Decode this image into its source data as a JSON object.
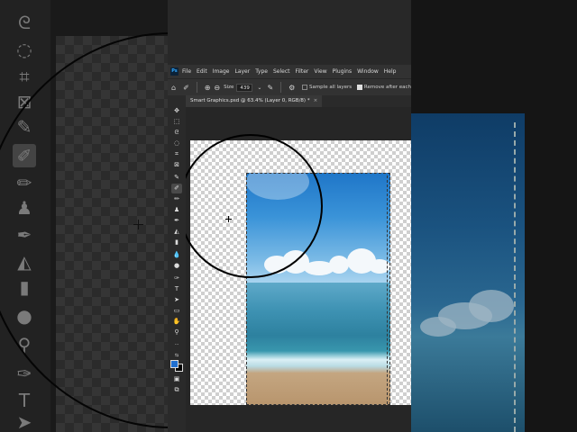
{
  "menubar": {
    "logo": "Ps",
    "items": [
      "File",
      "Edit",
      "Image",
      "Layer",
      "Type",
      "Select",
      "Filter",
      "View",
      "Plugins",
      "Window",
      "Help"
    ]
  },
  "options": {
    "size_label": "Size",
    "size_value": "439",
    "sample_all_layers": "Sample all layers",
    "remove_after": "Remove after each"
  },
  "document": {
    "tab_label": "Smart Graphics.psd @ 63.4% (Layer 0, RGB/8) *",
    "close": "×"
  },
  "tools": [
    {
      "name": "move-tool-icon",
      "glyph": "✥"
    },
    {
      "name": "marquee-tool-icon",
      "glyph": "⬚"
    },
    {
      "name": "lasso-tool-icon",
      "glyph": "ᘓ"
    },
    {
      "name": "object-selection-tool-icon",
      "glyph": "◌"
    },
    {
      "name": "crop-tool-icon",
      "glyph": "⌗"
    },
    {
      "name": "frame-tool-icon",
      "glyph": "⊠"
    },
    {
      "name": "eyedropper-tool-icon",
      "glyph": "✎"
    },
    {
      "name": "remove-tool-icon",
      "glyph": "✐"
    },
    {
      "name": "brush-tool-icon",
      "glyph": "✏"
    },
    {
      "name": "clone-stamp-tool-icon",
      "glyph": "♟"
    },
    {
      "name": "history-brush-tool-icon",
      "glyph": "✒"
    },
    {
      "name": "eraser-tool-icon",
      "glyph": "◭"
    },
    {
      "name": "gradient-tool-icon",
      "glyph": "▮"
    },
    {
      "name": "blur-tool-icon",
      "glyph": "💧"
    },
    {
      "name": "dodge-tool-icon",
      "glyph": "●"
    },
    {
      "name": "pen-tool-icon",
      "glyph": "✑"
    },
    {
      "name": "type-tool-icon",
      "glyph": "T"
    },
    {
      "name": "path-selection-tool-icon",
      "glyph": "➤"
    },
    {
      "name": "rectangle-tool-icon",
      "glyph": "▭"
    },
    {
      "name": "hand-tool-icon",
      "glyph": "✋"
    },
    {
      "name": "zoom-tool-icon",
      "glyph": "⚲"
    },
    {
      "name": "more-tools-icon",
      "glyph": "···"
    }
  ],
  "colors": {
    "foreground": "#1f6fd1",
    "background": "#000000",
    "ui_dark": "#262626"
  }
}
